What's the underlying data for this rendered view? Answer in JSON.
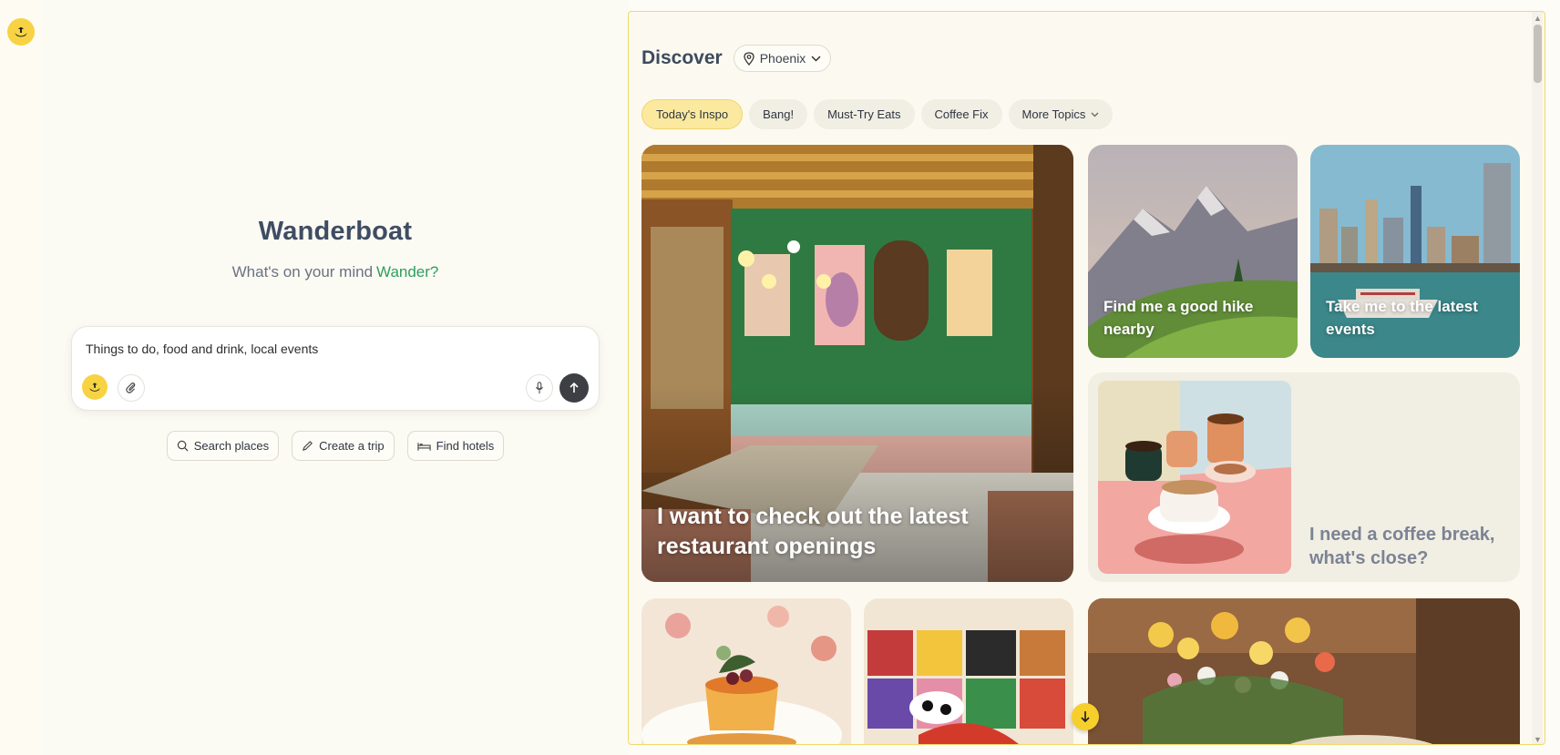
{
  "app": {
    "name": "Wanderboat",
    "tagline": "What's on your mind",
    "tagline_accent": "Wander?"
  },
  "composer": {
    "text": "Things to do, food and drink, local events"
  },
  "actions": [
    {
      "label": "Search places",
      "icon": "search-icon"
    },
    {
      "label": "Create a trip",
      "icon": "pencil-icon"
    },
    {
      "label": "Find hotels",
      "icon": "bed-icon"
    }
  ],
  "discover": {
    "title": "Discover",
    "location": "Phoenix",
    "topics": [
      "Today's Inspo",
      "Bang!",
      "Must-Try Eats",
      "Coffee Fix",
      "More Topics"
    ],
    "active_topic": "Today's Inspo",
    "cards": [
      {
        "caption": "I want to check out the latest restaurant openings"
      },
      {
        "caption": "Find me a good hike nearby"
      },
      {
        "caption": "Take me to the latest events"
      },
      {
        "caption": "I need a coffee break, what's close?"
      }
    ]
  },
  "colors": {
    "brand_yellow": "#f7d343",
    "accent_green": "#2f9e5e",
    "border_yellow": "#f2d86a"
  }
}
